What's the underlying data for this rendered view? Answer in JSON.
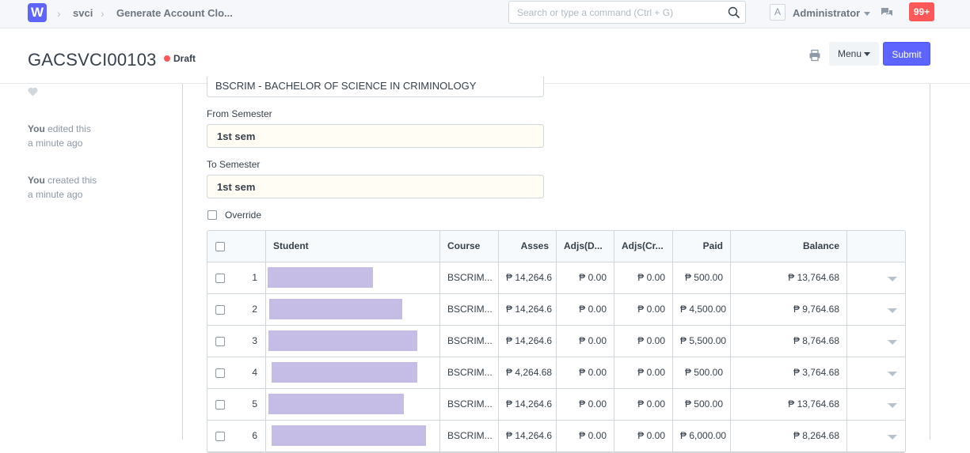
{
  "navbar": {
    "breadcrumbs": [
      "svci",
      "Generate Account Clo..."
    ],
    "search_placeholder": "Search or type a command (Ctrl + G)",
    "avatar_letter": "A",
    "user": "Administrator",
    "notifications": "99+"
  },
  "header": {
    "title": "GACSVCI00103",
    "status": "Draft",
    "menu_label": "Menu",
    "submit_label": "Submit"
  },
  "sidebar": {
    "timeline": [
      {
        "who": "You",
        "action": "edited this",
        "when": "a minute ago"
      },
      {
        "who": "You",
        "action": "created this",
        "when": "a minute ago"
      }
    ]
  },
  "form": {
    "program_value": "BSCRIM - BACHELOR OF SCIENCE IN CRIMINOLOGY",
    "from_semester_label": "From Semester",
    "from_semester_value": "1st sem",
    "to_semester_label": "To Semester",
    "to_semester_value": "1st sem",
    "override_label": "Override"
  },
  "grid": {
    "columns": [
      "Student",
      "Course",
      "Asses",
      "Adjs(D...",
      "Adjs(Cr...",
      "Paid",
      "Balance"
    ],
    "rows": [
      {
        "idx": "1",
        "course": "BSCRIM...",
        "asses": "₱ 14,264.6",
        "adjd": "₱ 0.00",
        "adjc": "₱ 0.00",
        "paid": "₱ 500.00",
        "balance": "₱ 13,764.68"
      },
      {
        "idx": "2",
        "course": "BSCRIM...",
        "asses": "₱ 14,264.6",
        "adjd": "₱ 0.00",
        "adjc": "₱ 0.00",
        "paid": "₱ 4,500.00",
        "balance": "₱ 9,764.68"
      },
      {
        "idx": "3",
        "course": "BSCRIM...",
        "asses": "₱ 14,264.6",
        "adjd": "₱ 0.00",
        "adjc": "₱ 0.00",
        "paid": "₱ 5,500.00",
        "balance": "₱ 8,764.68"
      },
      {
        "idx": "4",
        "course": "BSCRIM...",
        "asses": "₱ 4,264.68",
        "adjd": "₱ 0.00",
        "adjc": "₱ 0.00",
        "paid": "₱ 500.00",
        "balance": "₱ 3,764.68"
      },
      {
        "idx": "5",
        "course": "BSCRIM...",
        "asses": "₱ 14,264.6",
        "adjd": "₱ 0.00",
        "adjc": "₱ 0.00",
        "paid": "₱ 500.00",
        "balance": "₱ 13,764.68"
      },
      {
        "idx": "6",
        "course": "BSCRIM...",
        "asses": "₱ 14,264.6",
        "adjd": "₱ 0.00",
        "adjc": "₱ 0.00",
        "paid": "₱ 6,000.00",
        "balance": "₱ 8,264.68"
      }
    ]
  }
}
